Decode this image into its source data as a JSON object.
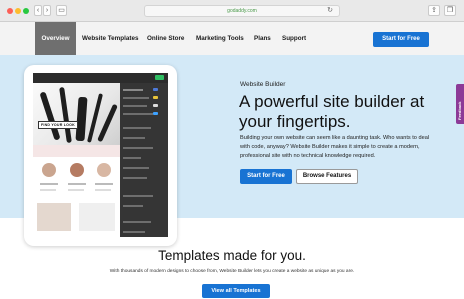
{
  "browser": {
    "url": "godaddy.com",
    "back_glyph": "‹",
    "forward_glyph": "›",
    "sidebar_glyph": "▭",
    "reload_glyph": "↻",
    "share_glyph": "⇪",
    "tabs_glyph": "❐"
  },
  "nav": {
    "items": [
      "Overview",
      "Website Templates",
      "Online Store",
      "Marketing Tools",
      "Plans",
      "Support"
    ],
    "active_index": 0,
    "cta": "Start for Free"
  },
  "mockup": {
    "overlay_text": "FIND YOUR LOOK"
  },
  "hero": {
    "kicker": "Website Builder",
    "title": "A powerful site builder at your fingertips.",
    "description": "Building your own website can seem like a daunting task. Who wants to deal with code, anyway? Website Builder makes it simple to create a modern, professional site with no technical knowledge required.",
    "primary_button": "Start for Free",
    "secondary_button": "Browse Features"
  },
  "side_tab": {
    "label": "Feedback"
  },
  "templates": {
    "title": "Templates made for you.",
    "description": "With thousands of modern designs to choose from, Website Builder lets you create a website as unique as you are.",
    "button": "View all Templates"
  },
  "colors": {
    "accent": "#1873d3",
    "hero_bg": "#d3e9f7",
    "nav_active": "#6f6f6f",
    "side_tab": "#8c3a97"
  }
}
